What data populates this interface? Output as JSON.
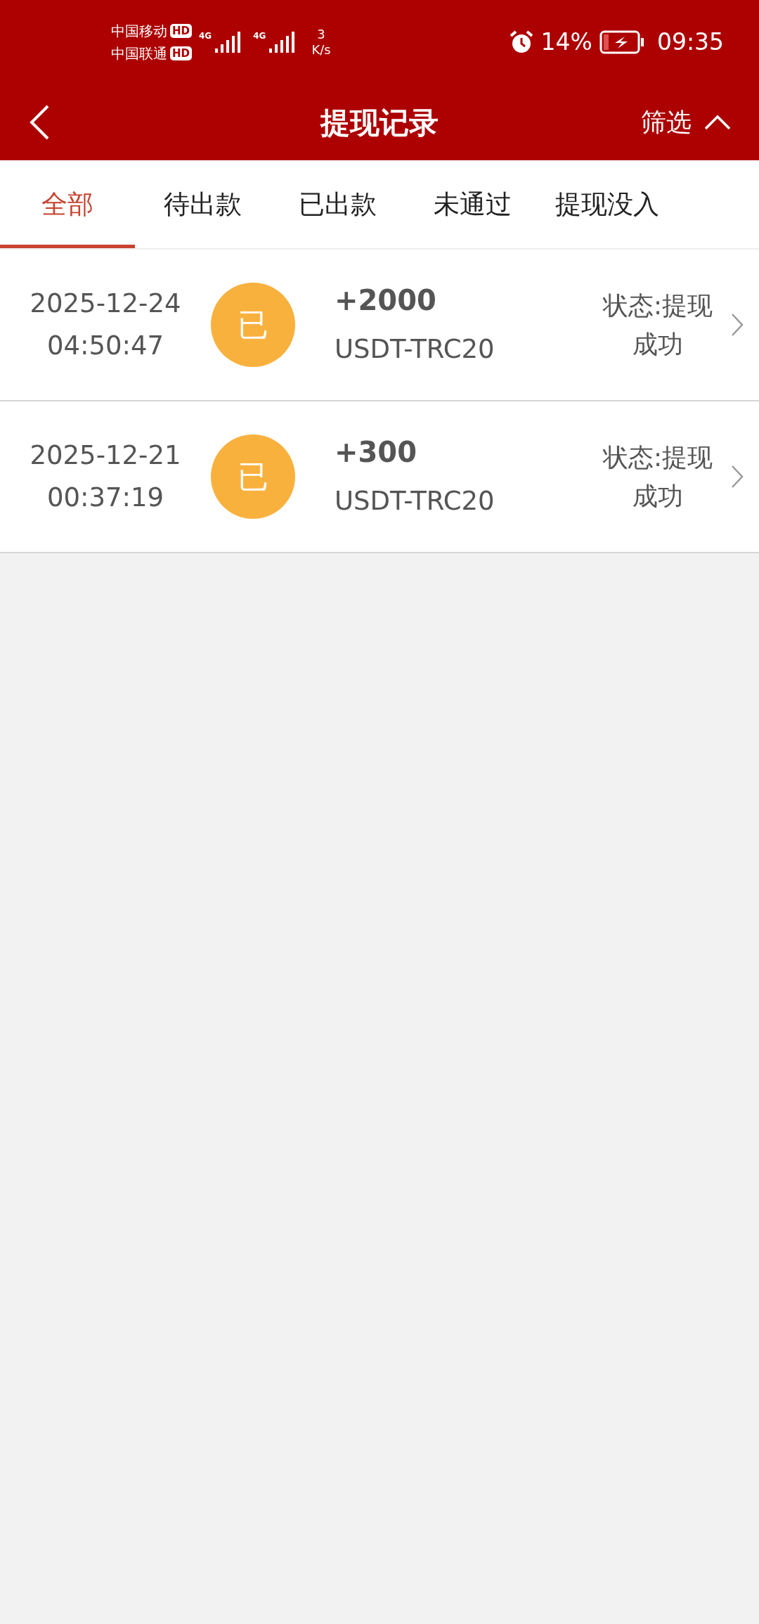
{
  "status_bar": {
    "carriers": [
      {
        "name": "中国移动",
        "badge": "HD"
      },
      {
        "name": "中国联通",
        "badge": "HD"
      }
    ],
    "signals": [
      {
        "label": "4G"
      },
      {
        "label": "4G"
      }
    ],
    "speed_value": "3",
    "speed_unit": "K/s",
    "battery": "14%",
    "time": "09:35"
  },
  "header": {
    "title": "提现记录",
    "filter": "筛选"
  },
  "tabs": [
    {
      "label": "全部",
      "selected": true
    },
    {
      "label": "待出款",
      "selected": false
    },
    {
      "label": "已出款",
      "selected": false
    },
    {
      "label": "未通过",
      "selected": false
    },
    {
      "label": "提现没入",
      "selected": false
    }
  ],
  "records": [
    {
      "date": "2025-12-24",
      "time": "04:50:47",
      "badge": "已",
      "amount": "+2000",
      "currency": "USDT-TRC20",
      "status": "状态:提现成功"
    },
    {
      "date": "2025-12-21",
      "time": "00:37:19",
      "badge": "已",
      "amount": "+300",
      "currency": "USDT-TRC20",
      "status": "状态:提现成功"
    }
  ]
}
